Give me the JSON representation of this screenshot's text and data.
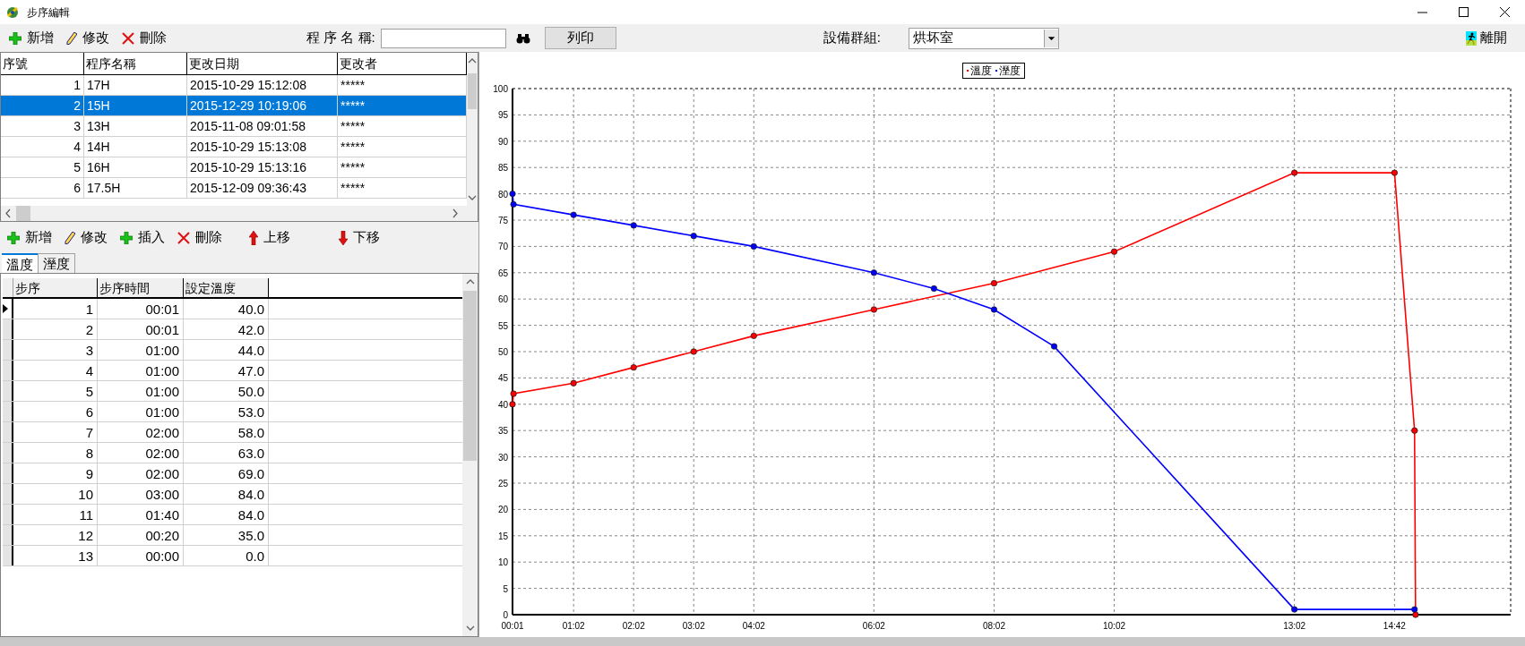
{
  "window": {
    "title": "步序編輯"
  },
  "toolbar": {
    "buttons": [
      {
        "kind": "add",
        "label": "新增"
      },
      {
        "kind": "edit",
        "label": "修改"
      },
      {
        "kind": "delete",
        "label": "刪除"
      }
    ],
    "program_name": {
      "label": "程 序 名 稱:"
    },
    "print_button": "列印",
    "device_group": {
      "label": "設備群組:",
      "value": "烘坏室"
    },
    "exit_button": "離開"
  },
  "programs": {
    "columns": [
      "序號",
      "程序名稱",
      "更改日期",
      "更改者"
    ],
    "rows": [
      {
        "cells": [
          "1",
          "17H",
          "2015-10-29 15:12:08",
          "*****"
        ],
        "selected": false
      },
      {
        "cells": [
          "2",
          "15H",
          "2015-12-29 10:19:06",
          "*****"
        ],
        "selected": true
      },
      {
        "cells": [
          "3",
          "13H",
          "2015-11-08 09:01:58",
          "*****"
        ],
        "selected": false
      },
      {
        "cells": [
          "4",
          "14H",
          "2015-10-29 15:13:08",
          "*****"
        ],
        "selected": false
      },
      {
        "cells": [
          "5",
          "16H",
          "2015-10-29 15:13:16",
          "*****"
        ],
        "selected": false
      },
      {
        "cells": [
          "6",
          "17.5H",
          "2015-12-09 09:36:43",
          "*****"
        ],
        "selected": false
      }
    ]
  },
  "step_toolbar": {
    "buttons": [
      {
        "kind": "add",
        "label": "新增"
      },
      {
        "kind": "edit",
        "label": "修改"
      },
      {
        "kind": "insert",
        "label": "插入"
      },
      {
        "kind": "delete",
        "label": "刪除"
      },
      {
        "kind": "up",
        "label": "上移"
      },
      {
        "kind": "down",
        "label": "下移"
      }
    ]
  },
  "tabs": [
    {
      "label": "溫度",
      "selected": true
    },
    {
      "label": "溼度",
      "selected": false
    }
  ],
  "steps": {
    "columns": [
      "步序",
      "步序時間",
      "設定溫度"
    ],
    "rows": [
      {
        "cells": [
          "1",
          "00:01",
          "40.0"
        ],
        "current": true
      },
      {
        "cells": [
          "2",
          "00:01",
          "42.0"
        ],
        "current": false
      },
      {
        "cells": [
          "3",
          "01:00",
          "44.0"
        ],
        "current": false
      },
      {
        "cells": [
          "4",
          "01:00",
          "47.0"
        ],
        "current": false
      },
      {
        "cells": [
          "5",
          "01:00",
          "50.0"
        ],
        "current": false
      },
      {
        "cells": [
          "6",
          "01:00",
          "53.0"
        ],
        "current": false
      },
      {
        "cells": [
          "7",
          "02:00",
          "58.0"
        ],
        "current": false
      },
      {
        "cells": [
          "8",
          "02:00",
          "63.0"
        ],
        "current": false
      },
      {
        "cells": [
          "9",
          "02:00",
          "69.0"
        ],
        "current": false
      },
      {
        "cells": [
          "10",
          "03:00",
          "84.0"
        ],
        "current": false
      },
      {
        "cells": [
          "11",
          "01:40",
          "84.0"
        ],
        "current": false
      },
      {
        "cells": [
          "12",
          "00:20",
          "35.0"
        ],
        "current": false
      },
      {
        "cells": [
          "13",
          "00:00",
          "0.0"
        ],
        "current": false
      }
    ]
  },
  "chart": {
    "chart_data": {
      "type": "line",
      "x": [
        1,
        2,
        62,
        122,
        182,
        242,
        362,
        422,
        482,
        542,
        602,
        782,
        882,
        902,
        903
      ],
      "grid": true,
      "legend": true,
      "series": [
        {
          "name": "溫度",
          "color": "#ff0000",
          "marker": "circle",
          "values": [
            40,
            42,
            44,
            47,
            50,
            53,
            58,
            null,
            63,
            null,
            69,
            84,
            84,
            35,
            0
          ]
        },
        {
          "name": "溼度",
          "color": "#0000ff",
          "marker": "circle",
          "values": [
            80,
            78,
            76,
            74,
            72,
            70,
            65,
            62,
            58,
            51,
            null,
            1,
            null,
            1,
            null
          ]
        }
      ],
      "xlim": [
        1,
        998
      ],
      "ylim": [
        0,
        100
      ],
      "xticks": [
        {
          "value": 1,
          "label": "00:01"
        },
        {
          "value": 62,
          "label": "01:02"
        },
        {
          "value": 122,
          "label": "02:02"
        },
        {
          "value": 182,
          "label": "03:02"
        },
        {
          "value": 242,
          "label": "04:02"
        },
        {
          "value": 362,
          "label": "06:02"
        },
        {
          "value": 482,
          "label": "08:02"
        },
        {
          "value": 602,
          "label": "10:02"
        },
        {
          "value": 782,
          "label": "13:02"
        },
        {
          "value": 882,
          "label": "14:42"
        }
      ],
      "yticks": [
        0,
        5,
        10,
        15,
        20,
        25,
        30,
        35,
        40,
        45,
        50,
        55,
        60,
        65,
        70,
        75,
        80,
        85,
        90,
        95,
        100
      ]
    }
  }
}
